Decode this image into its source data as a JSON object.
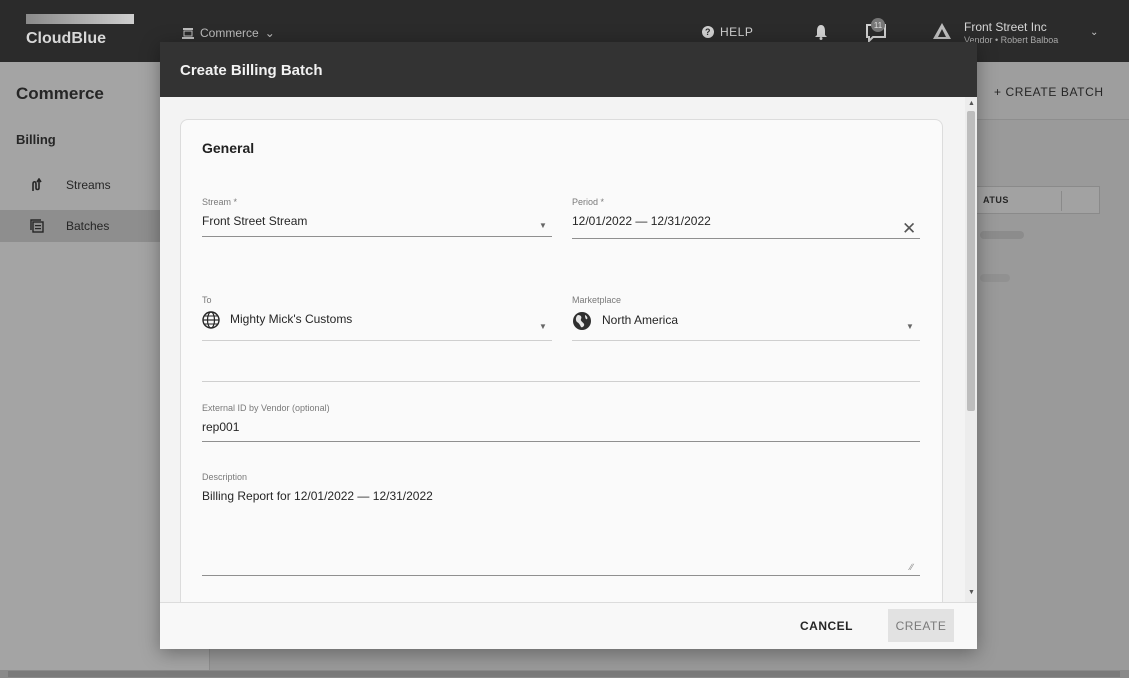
{
  "app": {
    "logo_text": "CloudBlue",
    "module": "Commerce",
    "help_label": "HELP",
    "notification_count": "11",
    "account_name": "Front Street Inc",
    "account_role": "Vendor • Robert Balboa"
  },
  "sidebar": {
    "title": "Commerce",
    "section": "Billing",
    "items": [
      {
        "label": "Streams",
        "icon": "streams-icon"
      },
      {
        "label": "Batches",
        "icon": "batches-icon",
        "active": true
      }
    ]
  },
  "page": {
    "create_batch_label": "+ CREATE BATCH",
    "table_header_status": "ATUS"
  },
  "modal": {
    "title": "Create Billing Batch",
    "section_title": "General",
    "stream": {
      "label": "Stream *",
      "value": "Front Street Stream"
    },
    "period": {
      "label": "Period *",
      "value": "12/01/2022 — 12/31/2022"
    },
    "to": {
      "label": "To",
      "value": "Mighty Mick's Customs",
      "icon": "globe-icon"
    },
    "marketplace": {
      "label": "Marketplace",
      "value": "North America",
      "icon": "globe-americas-icon"
    },
    "external_id": {
      "label": "External ID by Vendor (optional)",
      "value": "rep001"
    },
    "description": {
      "label": "Description",
      "value": "Billing Report for 12/01/2022 — 12/31/2022"
    },
    "cancel_label": "CANCEL",
    "create_label": "CREATE"
  }
}
